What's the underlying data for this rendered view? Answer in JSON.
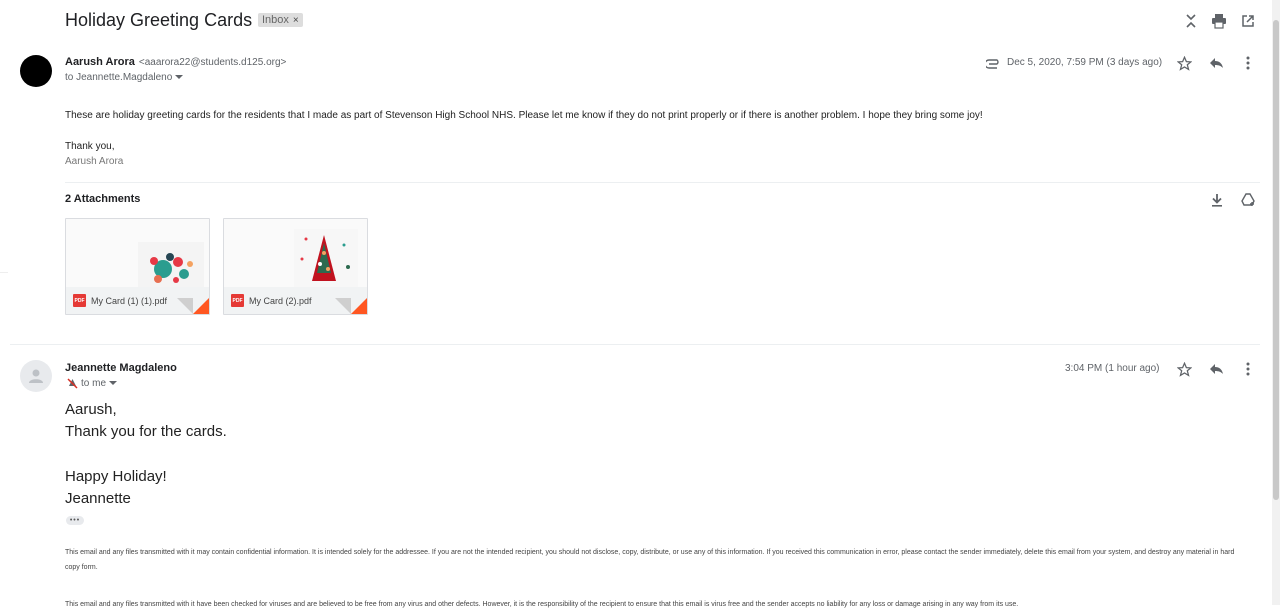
{
  "subject": "Holiday Greeting Cards",
  "label": "Inbox",
  "label_close": "×",
  "toolbar_icons": [
    "collapse-all-icon",
    "print-icon",
    "open-in-new-window-icon"
  ],
  "message1": {
    "sender_name": "Aarush Arora",
    "sender_email": "<aaarora22@students.d125.org>",
    "to": "to Jeannette.Magdaleno",
    "date": "Dec 5, 2020, 7:59 PM (3 days ago)",
    "body": "These are holiday greeting cards for the residents that I made as part of Stevenson High School NHS. Please let me know if they do not print properly or if there is another problem. I hope they bring some joy!",
    "signoff": "Thank you,",
    "signature": "Aarush Arora",
    "attachments_title": "2 Attachments",
    "attachments": [
      {
        "name": "My Card (1) (1).pdf",
        "badge": "PDF"
      },
      {
        "name": "My Card (2).pdf",
        "badge": "PDF"
      }
    ]
  },
  "message2": {
    "sender_name": "Jeannette Magdaleno",
    "to": "to me",
    "date": "3:04 PM (1 hour ago)",
    "lines": [
      "Aarush,",
      "Thank you for the cards.",
      "",
      "Happy Holiday!",
      "Jeannette"
    ],
    "trimmed": "•••",
    "disclaimer": "This email and any files transmitted with it may contain confidential information. It is intended solely for the addressee. If you are not the intended recipient, you should not disclose, copy, distribute, or use any of this information. If you received this communication in error, please contact the sender immediately, delete this email from your system, and destroy any material in hard copy form.",
    "disclaimer2": "This email and any files transmitted with it have been checked for viruses and are believed to be free from any virus and other defects. However, it is the responsibility of the recipient to ensure that this email is virus free and the sender accepts no liability for any loss or damage arising in any way from its use."
  },
  "colors": {
    "accent": "#ff5722",
    "pdf_red": "#e53935",
    "label_bg": "#dddddd"
  }
}
